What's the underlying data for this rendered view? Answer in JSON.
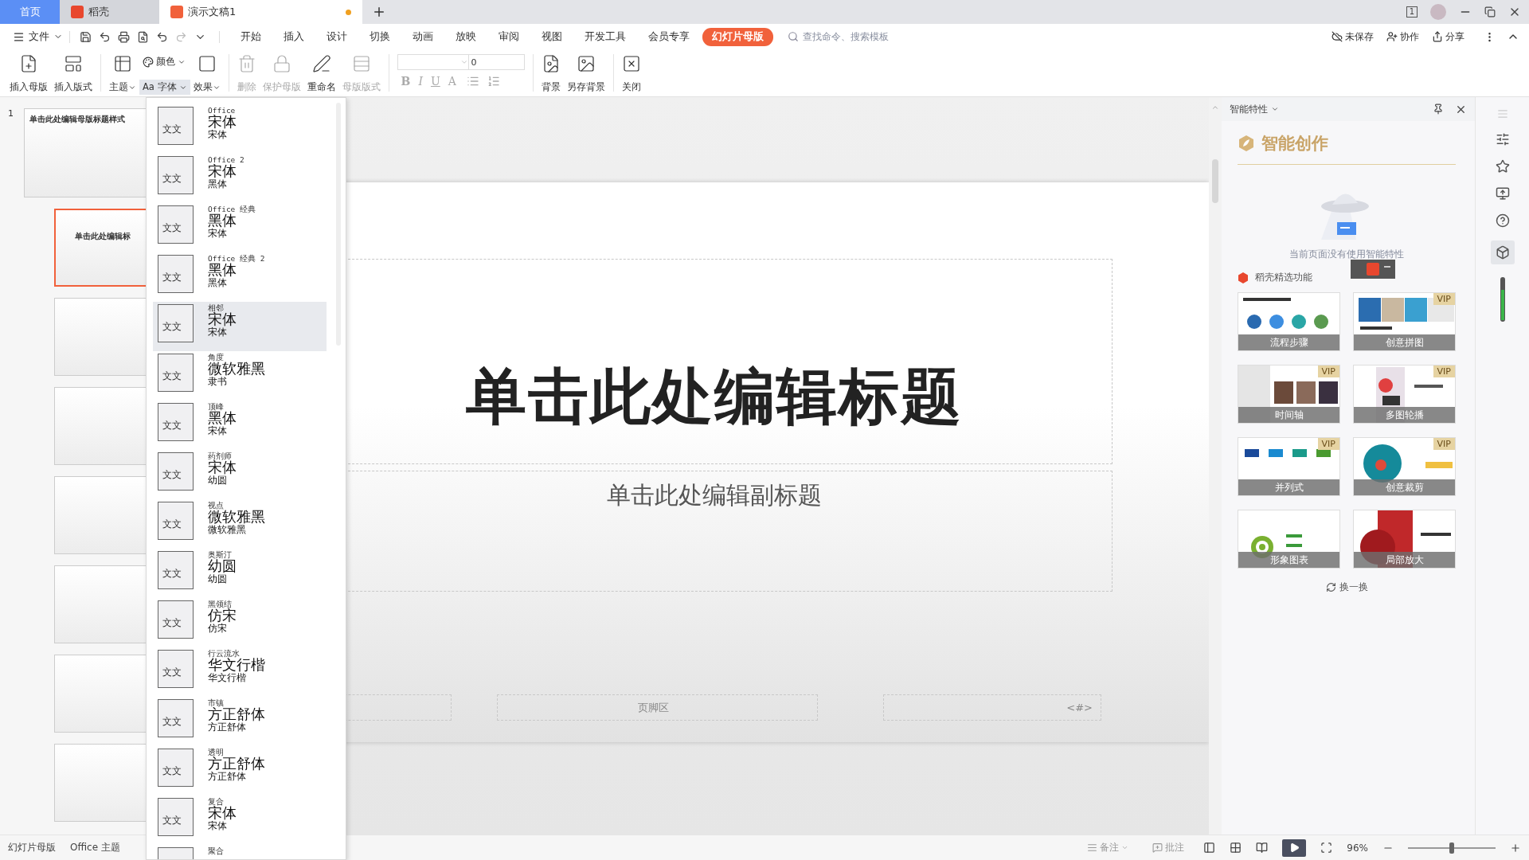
{
  "tabs": [
    {
      "label": "首页",
      "kind": "home",
      "selected": false
    },
    {
      "label": "稻壳",
      "kind": "docer",
      "selected": false
    },
    {
      "label": "演示文稿1",
      "kind": "document",
      "selected": true,
      "unsaved": true
    }
  ],
  "window_count": "1",
  "menu": {
    "file": "文件",
    "items": [
      {
        "label": "开始",
        "selected": false
      },
      {
        "label": "插入",
        "selected": false
      },
      {
        "label": "设计",
        "selected": false
      },
      {
        "label": "切换",
        "selected": false
      },
      {
        "label": "动画",
        "selected": false
      },
      {
        "label": "放映",
        "selected": false
      },
      {
        "label": "审阅",
        "selected": false
      },
      {
        "label": "视图",
        "selected": false
      },
      {
        "label": "开发工具",
        "selected": false
      },
      {
        "label": "会员专享",
        "selected": false
      },
      {
        "label": "幻灯片母版",
        "selected": true
      }
    ],
    "search": {
      "placeholder": "查找命令、搜索模板"
    },
    "actions": [
      "未保存",
      "协作",
      "分享"
    ]
  },
  "ribbon": [
    {
      "kind": "large",
      "label": "插入母版",
      "disabled": false,
      "dropdown": false
    },
    {
      "kind": "large",
      "label": "插入版式",
      "disabled": false,
      "dropdown": false
    },
    {
      "kind": "separator"
    },
    {
      "kind": "large",
      "label": "主题",
      "disabled": false,
      "dropdown": true
    },
    {
      "kind": "stack",
      "items": [
        {
          "label": "颜色",
          "selected": false
        },
        {
          "label": "Aa 字体",
          "selected": true
        }
      ]
    },
    {
      "kind": "large",
      "label": "效果",
      "disabled": false,
      "dropdown": true
    },
    {
      "kind": "separator"
    },
    {
      "kind": "large",
      "label": "删除",
      "disabled": true,
      "dropdown": false
    },
    {
      "kind": "large",
      "label": "保护母版",
      "disabled": true,
      "dropdown": false
    },
    {
      "kind": "large",
      "label": "重命名",
      "disabled": false,
      "dropdown": false
    },
    {
      "kind": "large",
      "label": "母版版式",
      "disabled": true,
      "dropdown": false
    },
    {
      "kind": "separator"
    },
    {
      "kind": "font",
      "size": "0",
      "buttons": [
        {
          "label": "B",
          "disabled": true
        },
        {
          "label": "I",
          "disabled": true
        },
        {
          "label": "U",
          "disabled": true
        },
        {
          "label": "A",
          "disabled": true
        }
      ]
    },
    {
      "kind": "separator"
    },
    {
      "kind": "large",
      "label": "背景",
      "disabled": false,
      "dropdown": false
    },
    {
      "kind": "large",
      "label": "另存背景",
      "disabled": false,
      "dropdown": false
    },
    {
      "kind": "separator"
    },
    {
      "kind": "large",
      "label": "关闭",
      "disabled": false,
      "dropdown": false
    }
  ],
  "font_menu": [
    {
      "name": "Office",
      "heading": "宋体",
      "body": "宋体",
      "sample": "文文",
      "selected": false
    },
    {
      "name": "Office 2",
      "heading": "宋体",
      "body": "黑体",
      "sample": "文文",
      "selected": false
    },
    {
      "name": "Office 经典",
      "heading": "黑体",
      "body": "宋体",
      "sample": "文文",
      "selected": false
    },
    {
      "name": "Office 经典 2",
      "heading": "黑体",
      "body": "黑体",
      "sample": "文文",
      "selected": false
    },
    {
      "name": "相邻",
      "heading": "宋体",
      "body": "宋体",
      "sample": "文文",
      "selected": true
    },
    {
      "name": "角度",
      "heading": "微软雅黑",
      "body": "隶书",
      "sample": "文文",
      "selected": false
    },
    {
      "name": "顶峰",
      "heading": "黑体",
      "body": "宋体",
      "sample": "文文",
      "selected": false
    },
    {
      "name": "药剂师",
      "heading": "宋体",
      "body": "幼圆",
      "sample": "文文",
      "selected": false
    },
    {
      "name": "视点",
      "heading": "微软雅黑",
      "body": "微软雅黑",
      "sample": "文文",
      "selected": false
    },
    {
      "name": "奥斯汀",
      "heading": "幼圆",
      "body": "幼圆",
      "sample": "文文",
      "selected": false
    },
    {
      "name": "黑领结",
      "heading": "仿宋",
      "body": "仿宋",
      "sample": "文文",
      "selected": false
    },
    {
      "name": "行云流水",
      "heading": "华文行楷",
      "body": "华文行楷",
      "sample": "文文",
      "selected": false
    },
    {
      "name": "市镇",
      "heading": "方正舒体",
      "body": "方正舒体",
      "sample": "文文",
      "selected": false
    },
    {
      "name": "透明",
      "heading": "方正舒体",
      "body": "方正舒体",
      "sample": "文文",
      "selected": false
    },
    {
      "name": "复合",
      "heading": "宋体",
      "body": "宋体",
      "sample": "文文",
      "selected": false
    },
    {
      "name": "聚合",
      "selected": false
    }
  ],
  "slides": [
    {
      "kind": "master",
      "number": "1",
      "title": "单击此处编辑母版标题样式",
      "selected": false
    },
    {
      "kind": "layout",
      "title": "单击此处编辑标",
      "selected": true
    },
    {
      "kind": "layout",
      "selected": false
    },
    {
      "kind": "layout",
      "selected": false
    },
    {
      "kind": "layout",
      "selected": false
    },
    {
      "kind": "layout",
      "selected": false
    },
    {
      "kind": "layout",
      "selected": false
    },
    {
      "kind": "layout",
      "selected": false
    }
  ],
  "slide": {
    "title": "单击此处编辑标题",
    "subtitle": "单击此处编辑副标题",
    "footer": "页脚区",
    "number": "<#>"
  },
  "panel": {
    "title": "智能特性",
    "heading": "智能创作",
    "empty": "当前页面没有使用智能特性",
    "section": "稻壳精选功能",
    "card_rows": [
      [
        {
          "label": "流程步骤"
        },
        {
          "label": "创意拼图",
          "badge": "VIP"
        }
      ],
      [
        {
          "label": "时间轴",
          "badge": "VIP"
        },
        {
          "label": "多图轮播",
          "badge": "VIP"
        }
      ],
      [
        {
          "label": "并列式",
          "badge": "VIP"
        },
        {
          "label": "创意裁剪",
          "badge": "VIP"
        }
      ],
      [
        {
          "label": "形象图表"
        },
        {
          "label": "局部放大"
        }
      ]
    ],
    "refresh": "换一换"
  },
  "status": {
    "left": [
      "幻灯片母版",
      "Office 主题"
    ],
    "notes": "备注",
    "comments": "批注",
    "zoom": "96%",
    "zoom_slider": {
      "level": 0.5
    }
  }
}
